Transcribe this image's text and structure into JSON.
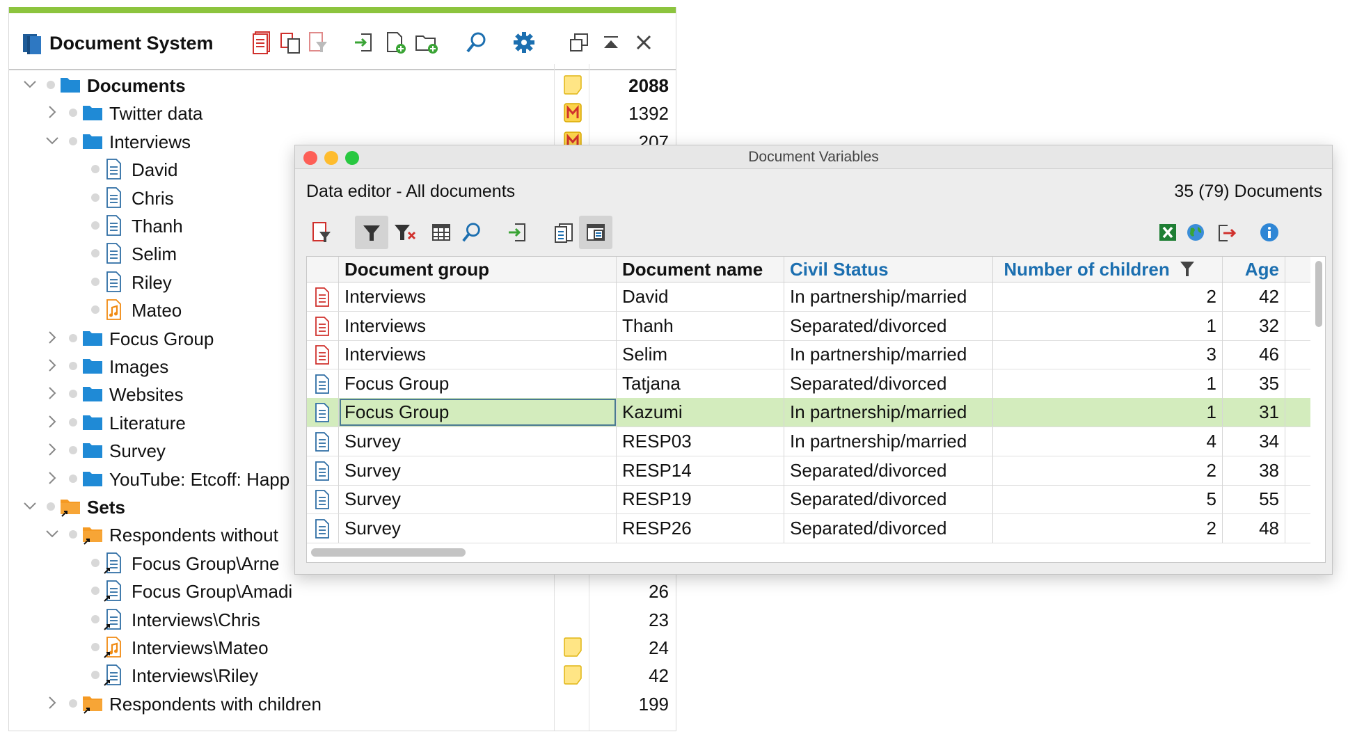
{
  "document_system": {
    "title": "Document System",
    "toolbar_icons": [
      "new-document-icon",
      "copy-documents-icon",
      "filter-documents-icon",
      "import-icon",
      "add-document-icon",
      "add-folder-icon",
      "search-icon",
      "settings-icon",
      "undock-window-icon",
      "collapse-window-icon",
      "close-icon"
    ],
    "tree": [
      {
        "label": "Documents",
        "count": "2088",
        "level": 0,
        "type": "folder",
        "expanded": true,
        "bold": true,
        "memo": "plain"
      },
      {
        "label": "Twitter data",
        "count": "1392",
        "level": 1,
        "type": "folder",
        "expanded": false,
        "memo": "M"
      },
      {
        "label": "Interviews",
        "count": "207",
        "level": 1,
        "type": "folder",
        "expanded": true,
        "memo": "M"
      },
      {
        "label": "David",
        "count": "",
        "level": 2,
        "type": "doc"
      },
      {
        "label": "Chris",
        "count": "",
        "level": 2,
        "type": "doc"
      },
      {
        "label": "Thanh",
        "count": "",
        "level": 2,
        "type": "doc"
      },
      {
        "label": "Selim",
        "count": "",
        "level": 2,
        "type": "doc"
      },
      {
        "label": "Riley",
        "count": "",
        "level": 2,
        "type": "doc"
      },
      {
        "label": "Mateo",
        "count": "",
        "level": 2,
        "type": "audio"
      },
      {
        "label": "Focus Group",
        "count": "",
        "level": 1,
        "type": "folder",
        "expanded": false
      },
      {
        "label": "Images",
        "count": "",
        "level": 1,
        "type": "folder",
        "expanded": false
      },
      {
        "label": "Websites",
        "count": "",
        "level": 1,
        "type": "folder",
        "expanded": false
      },
      {
        "label": "Literature",
        "count": "",
        "level": 1,
        "type": "folder",
        "expanded": false
      },
      {
        "label": "Survey",
        "count": "",
        "level": 1,
        "type": "folder",
        "expanded": false
      },
      {
        "label": "YouTube: Etcoff: Happ",
        "count": "",
        "level": 1,
        "type": "folder",
        "expanded": false
      },
      {
        "label": "Sets",
        "count": "",
        "level": 0,
        "type": "set",
        "expanded": true,
        "bold": true
      },
      {
        "label": "Respondents without",
        "count": "",
        "level": 1,
        "type": "set",
        "expanded": true
      },
      {
        "label": "Focus Group\\Arne",
        "count": "",
        "level": 2,
        "type": "doc-link"
      },
      {
        "label": "Focus Group\\Amadi",
        "count": "26",
        "level": 2,
        "type": "doc-link"
      },
      {
        "label": "Interviews\\Chris",
        "count": "23",
        "level": 2,
        "type": "doc-link"
      },
      {
        "label": "Interviews\\Mateo",
        "count": "24",
        "level": 2,
        "type": "audio-link",
        "memo": "plain"
      },
      {
        "label": "Interviews\\Riley",
        "count": "42",
        "level": 2,
        "type": "doc-link",
        "memo": "plain"
      },
      {
        "label": "Respondents with children",
        "count": "199",
        "level": 1,
        "type": "set",
        "expanded": false
      }
    ]
  },
  "document_variables": {
    "window_title": "Document Variables",
    "subtitle": "Data editor - All documents",
    "doc_count": "35 (79) Documents",
    "toolbar_icons": [
      "filter-docs-icon",
      "filter-icon",
      "clear-filter-icon",
      "columns-icon",
      "search-icon",
      "import-icon",
      "list-variables-icon",
      "data-editor-icon",
      "excel-icon",
      "web-icon",
      "export-icon",
      "info-icon"
    ],
    "colors": {
      "selected_row": "#d3ecbd",
      "header_link": "#1c6fb0",
      "doc_red": "#d0312d",
      "doc_blue": "#2e6da4"
    },
    "columns": [
      {
        "label": "Document group",
        "blue": false
      },
      {
        "label": "Document name",
        "blue": false
      },
      {
        "label": "Civil Status",
        "blue": true
      },
      {
        "label": "Number of children",
        "blue": true,
        "filtered": true
      },
      {
        "label": "Age",
        "blue": true
      }
    ],
    "rows": [
      {
        "icon": "red",
        "group": "Interviews",
        "name": "David",
        "status": "In partnership/married",
        "children": "2",
        "age": "42"
      },
      {
        "icon": "red",
        "group": "Interviews",
        "name": "Thanh",
        "status": "Separated/divorced",
        "children": "1",
        "age": "32"
      },
      {
        "icon": "red",
        "group": "Interviews",
        "name": "Selim",
        "status": "In partnership/married",
        "children": "3",
        "age": "46"
      },
      {
        "icon": "blue",
        "group": "Focus Group",
        "name": "Tatjana",
        "status": "Separated/divorced",
        "children": "1",
        "age": "35"
      },
      {
        "icon": "blue",
        "group": "Focus Group",
        "name": "Kazumi",
        "status": "In partnership/married",
        "children": "1",
        "age": "31",
        "selected": true
      },
      {
        "icon": "blue",
        "group": "Survey",
        "name": "RESP03",
        "status": "In partnership/married",
        "children": "4",
        "age": "34"
      },
      {
        "icon": "blue",
        "group": "Survey",
        "name": "RESP14",
        "status": "Separated/divorced",
        "children": "2",
        "age": "38"
      },
      {
        "icon": "blue",
        "group": "Survey",
        "name": "RESP19",
        "status": "Separated/divorced",
        "children": "5",
        "age": "55"
      },
      {
        "icon": "blue",
        "group": "Survey",
        "name": "RESP26",
        "status": "Separated/divorced",
        "children": "2",
        "age": "48"
      }
    ]
  }
}
